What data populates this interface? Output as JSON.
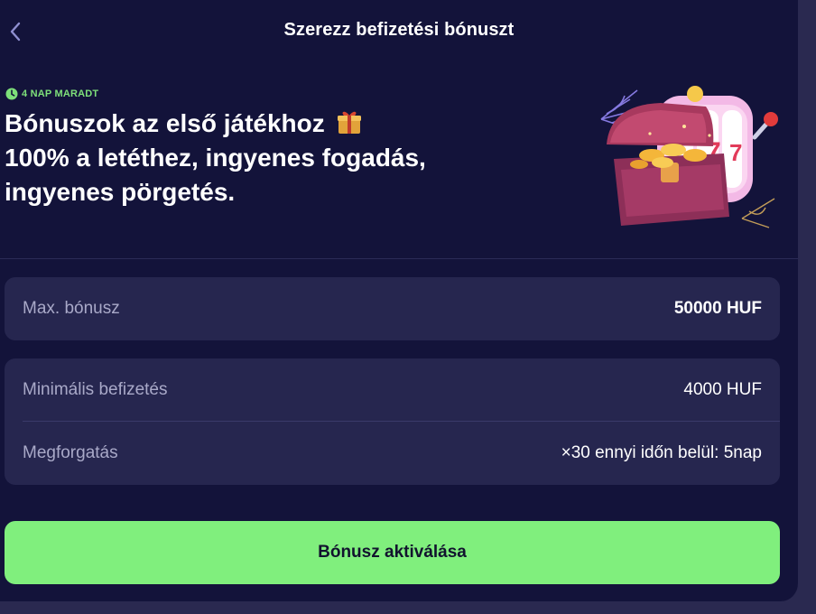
{
  "header": {
    "title": "Szerezz befizetési bónuszt",
    "back_icon": "chevron-left-icon"
  },
  "hero": {
    "timer_label": "4 NAP MARADT",
    "timer_icon": "clock-icon",
    "line1": "Bónuszok az első játékhoz",
    "line1_icon": "gift-icon",
    "line2": "100% a letéthez, ingyenes fogadás,",
    "line3": "ingyenes pörgetés.",
    "art": "treasure-chest-slot-machine-illustration"
  },
  "details": {
    "max_bonus": {
      "label": "Max. bónusz",
      "value": "50000 HUF"
    },
    "min_deposit": {
      "label": "Minimális befizetés",
      "value": "4000 HUF"
    },
    "wagering": {
      "label": "Megforgatás",
      "value": "×30 ennyi időn belül: 5nap"
    }
  },
  "cta": {
    "label": "Bónusz aktiválása"
  },
  "colors": {
    "background": "#13133a",
    "card": "#26264f",
    "accent_green": "#80ef7d",
    "timer_green": "#7ee07a"
  }
}
